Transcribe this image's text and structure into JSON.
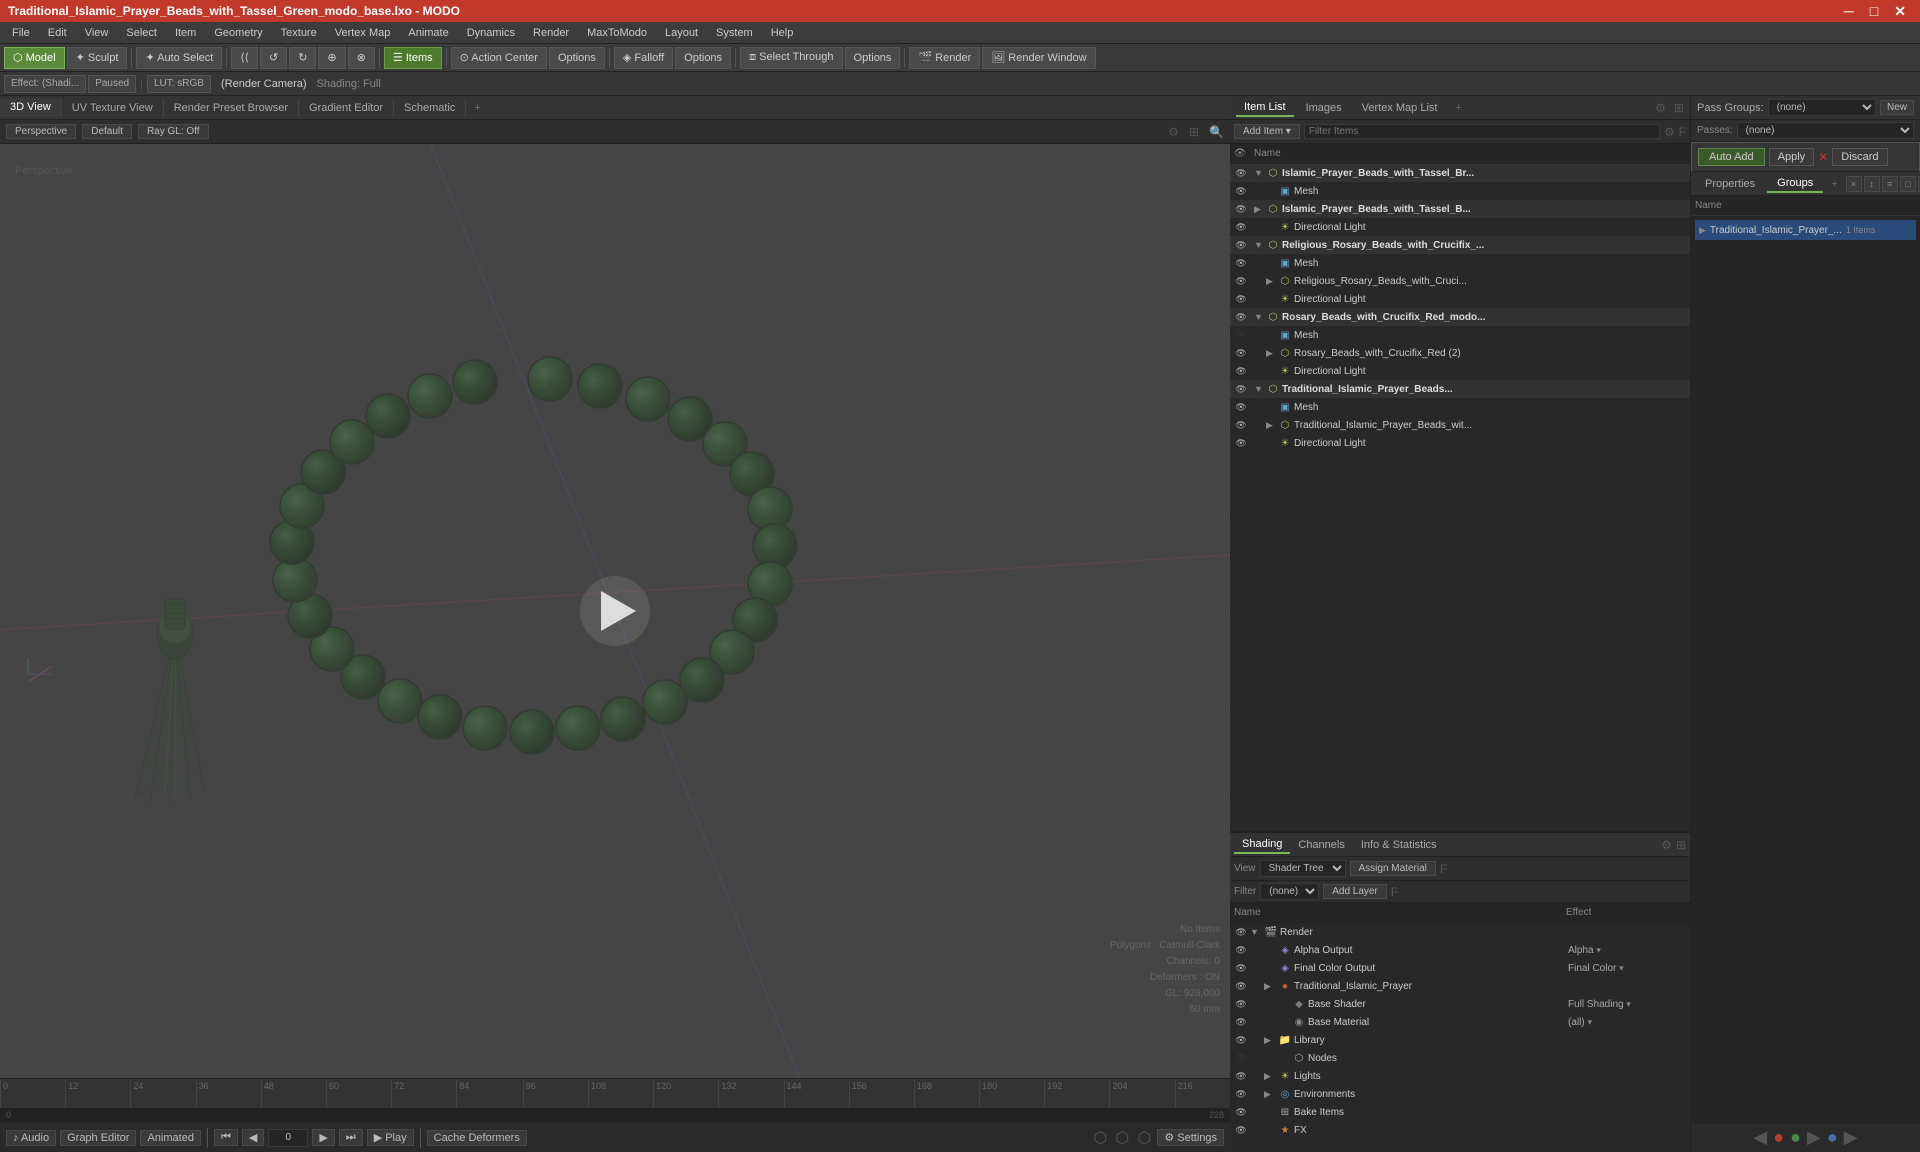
{
  "title_bar": {
    "title": "Traditional_Islamic_Prayer_Beads_with_Tassel_Green_modo_base.lxo - MODO",
    "minimize": "─",
    "maximize": "□",
    "close": "✕"
  },
  "menu_bar": {
    "items": [
      "File",
      "Edit",
      "View",
      "Select",
      "Item",
      "Geometry",
      "Texture",
      "Vertex Map",
      "Animate",
      "Dynamics",
      "Render",
      "MaxToModo",
      "Layout",
      "System",
      "Help"
    ]
  },
  "toolbar": {
    "mode_model": "Model",
    "mode_sculpt": "Sculpt",
    "auto_select": "Auto Select",
    "btn_icons": [
      "▶▶",
      "◀",
      "▶",
      "⟳",
      "⟳"
    ],
    "items_btn": "Items",
    "action_center": "Action Center",
    "options1": "Options",
    "falloff": "Falloff",
    "options2": "Options",
    "select_through": "Select Through",
    "options3": "Options",
    "render": "Render",
    "render_window": "Render Window"
  },
  "sub_toolbar": {
    "effect": "Effect: (Shadi...",
    "paused": "Paused",
    "lut": "LUT: sRGB",
    "render_camera": "(Render Camera)",
    "shading": "Shading: Full"
  },
  "view_tabs": {
    "tabs": [
      "3D View",
      "UV Texture View",
      "Render Preset Browser",
      "Gradient Editor",
      "Schematic"
    ],
    "add": "+",
    "active": "3D View"
  },
  "viewport": {
    "header": {
      "perspective": "Perspective",
      "default": "Default",
      "ray_gl": "Ray GL: Off"
    },
    "info": {
      "no_items": "No Items",
      "polygons": "Polygons : Catmull-Clark",
      "channels": "Channels: 0",
      "deformers": "Deformers : ON",
      "gl": "GL: 928,000",
      "distance": "50 mm"
    },
    "timeline_ticks": [
      "0",
      "12",
      "24",
      "36",
      "48",
      "60",
      "72",
      "84",
      "96",
      "108",
      "120",
      "132",
      "144",
      "156",
      "168",
      "180",
      "192",
      "204",
      "216"
    ],
    "timeline_end": "228"
  },
  "transport": {
    "audio": "♪ Audio",
    "graph_editor": "Graph Editor",
    "animated": "Animated",
    "prev_keyframe": "◀◀",
    "prev": "◀",
    "frame_field": "0",
    "next": "▶",
    "next_keyframe": "▶▶",
    "play": "▶ Play",
    "cache": "Cache Deformers",
    "settings": "⚙ Settings"
  },
  "item_list": {
    "panel_tabs": [
      "Item List",
      "Images",
      "Vertex Map List"
    ],
    "add_item": "Add Item",
    "filter_placeholder": "Filter Items",
    "col_name": "Name",
    "items": [
      {
        "level": 0,
        "type": "group",
        "name": "Islamic_Prayer_Beads_with_Tassel_Br...",
        "visible": true,
        "expanded": true
      },
      {
        "level": 1,
        "type": "mesh",
        "name": "Mesh",
        "visible": true
      },
      {
        "level": 0,
        "type": "group",
        "name": "Islamic_Prayer_Beads_with_Tassel_B...",
        "visible": true,
        "expanded": false
      },
      {
        "level": 1,
        "type": "light",
        "name": "Directional Light",
        "visible": true
      },
      {
        "level": 0,
        "type": "group",
        "name": "Religious_Rosary_Beads_with_Crucifix_...",
        "visible": true,
        "expanded": true
      },
      {
        "level": 1,
        "type": "mesh",
        "name": "Mesh",
        "visible": true,
        "expanded": false
      },
      {
        "level": 1,
        "type": "group",
        "name": "Religious_Rosary_Beads_with_Cruci...",
        "visible": true,
        "expanded": false
      },
      {
        "level": 1,
        "type": "light",
        "name": "Directional Light",
        "visible": true
      },
      {
        "level": 0,
        "type": "group",
        "name": "Rosary_Beads_with_Crucifix_Red_modo...",
        "visible": true,
        "expanded": true
      },
      {
        "level": 1,
        "type": "mesh",
        "name": "Mesh",
        "visible": false
      },
      {
        "level": 1,
        "type": "group",
        "name": "Rosary_Beads_with_Crucifix_Red (2)",
        "visible": true,
        "expanded": false
      },
      {
        "level": 1,
        "type": "light",
        "name": "Directional Light",
        "visible": true
      },
      {
        "level": 0,
        "type": "group",
        "name": "Traditional_Islamic_Prayer_Beads...",
        "visible": true,
        "expanded": true,
        "selected": true
      },
      {
        "level": 1,
        "type": "mesh",
        "name": "Mesh",
        "visible": true
      },
      {
        "level": 1,
        "type": "group",
        "name": "Traditional_Islamic_Prayer_Beads_wit...",
        "visible": true,
        "expanded": false
      },
      {
        "level": 1,
        "type": "light",
        "name": "Directional Light",
        "visible": true
      }
    ]
  },
  "pass_groups": {
    "label": "Pass Groups:",
    "value": "(none)",
    "new_btn": "New",
    "passes_label": "Passes:",
    "passes_value": "(none)"
  },
  "auto_add": {
    "btn": "Auto Add",
    "apply": "Apply",
    "discard": "Discard"
  },
  "properties_groups": {
    "tabs": [
      "Properties",
      "Groups"
    ],
    "add": "+",
    "active": "Groups",
    "icon_btns": [
      "×",
      "↕",
      "≡",
      "□",
      "□"
    ]
  },
  "groups_panel": {
    "col_name": "Name",
    "items": [
      {
        "name": "Traditional_Islamic_Prayer_...",
        "count": "1 Items",
        "selected": true
      }
    ]
  },
  "shading": {
    "tabs": [
      "Shading",
      "Channels",
      "Info & Statistics"
    ],
    "active_tab": "Shading",
    "view_label": "View",
    "view_value": "Shader Tree",
    "assign_material": "Assign Material",
    "filter_label": "Filter",
    "filter_value": "(none)",
    "add_layer": "Add Layer",
    "col_name": "Name",
    "col_effect": "Effect",
    "shader_items": [
      {
        "level": 0,
        "type": "render",
        "name": "Render",
        "effect": "",
        "visible": true,
        "expanded": true
      },
      {
        "level": 1,
        "type": "output",
        "name": "Alpha Output",
        "effect": "Alpha",
        "visible": true,
        "has_dropdown": true
      },
      {
        "level": 1,
        "type": "output",
        "name": "Final Color Output",
        "effect": "Final Color",
        "visible": true,
        "has_dropdown": true
      },
      {
        "level": 1,
        "type": "material",
        "name": "Traditional_Islamic_Prayer",
        "effect": "",
        "visible": true,
        "expanded": false,
        "has_dropdown": false
      },
      {
        "level": 2,
        "type": "shader",
        "name": "Base Shader",
        "effect": "Full Shading",
        "visible": true,
        "has_dropdown": true
      },
      {
        "level": 2,
        "type": "material",
        "name": "Base Material",
        "effect": "(all)",
        "visible": true,
        "has_dropdown": true
      },
      {
        "level": 1,
        "type": "folder",
        "name": "Library",
        "effect": "",
        "visible": true,
        "expanded": false
      },
      {
        "level": 2,
        "type": "folder",
        "name": "Nodes",
        "effect": "",
        "visible": false
      },
      {
        "level": 1,
        "type": "folder",
        "name": "Lights",
        "effect": "",
        "visible": true,
        "expanded": false
      },
      {
        "level": 1,
        "type": "folder",
        "name": "Environments",
        "effect": "",
        "visible": true,
        "expanded": false
      },
      {
        "level": 1,
        "type": "item",
        "name": "Bake Items",
        "effect": "",
        "visible": true
      },
      {
        "level": 1,
        "type": "fx",
        "name": "FX",
        "effect": "",
        "visible": true
      }
    ]
  }
}
